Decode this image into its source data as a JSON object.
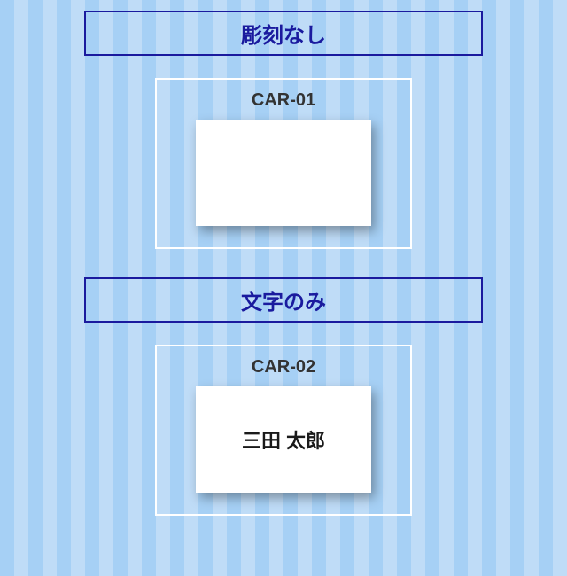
{
  "sections": [
    {
      "header": "彫刻なし",
      "card_label": "CAR-01",
      "card_text": ""
    },
    {
      "header": "文字のみ",
      "card_label": "CAR-02",
      "card_text": "三田 太郎"
    }
  ]
}
